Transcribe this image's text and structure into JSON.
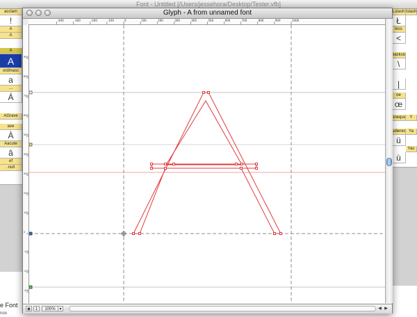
{
  "background_window": {
    "title": "Font - Untitled [/Users/jessehora/Desktop/Tester.vfb]",
    "left_columns": [
      {
        "header": "uni0041",
        "glyph": "!"
      },
      {
        "header": "A",
        "glyph": "A",
        "selected": true
      },
      {
        "header": "ordfeminine",
        "glyph": "a"
      },
      {
        "header": "...",
        "glyph": "À"
      },
      {
        "header": "Aacute",
        "glyph": "Á"
      },
      {
        "header": "...",
        "glyph": "â"
      },
      {
        "header": "ref",
        "glyph": ""
      }
    ],
    "left_headers_extra": [
      "acclam",
      "A",
      "ordmasc",
      "AGrave",
      "Acircumflex",
      "ave",
      "ef"
    ],
    "left_small_labels": [
      "A",
      "A",
      "A"
    ],
    "left_row_labels": [
      ".null",
      "Aacute"
    ],
    "right_columns": [
      {
        "header": "Lslash",
        "glyph": "Ł"
      },
      {
        "header": "less",
        "glyph": "<"
      },
      {
        "header": "backslash",
        "glyph": "\\"
      },
      {
        "header": "bar",
        "glyph": "|"
      },
      {
        "header": "oe",
        "glyph": "œ"
      },
      {
        "header": "onequarter",
        "glyph": "¼"
      },
      {
        "header": "udieresis",
        "glyph": "ü"
      },
      {
        "header": "udieresis",
        "glyph": "ù"
      }
    ],
    "right_far_headers": [
      "lslash",
      "Y",
      "Ya",
      "3/4",
      "Yac",
      "Ya",
      "Z"
    ],
    "bottom_text": "e Font",
    "bottom_text_small": "noo"
  },
  "glyph_window": {
    "title": "Glyph - A from unnamed font",
    "zoom": "100%",
    "status_button_1": "1",
    "ruler_top_labels": [
      "-400",
      "-300",
      "-200",
      "-100",
      "0",
      "100",
      "200",
      "300",
      "400",
      "500",
      "600",
      "700",
      "800",
      "900",
      "1000"
    ],
    "ruler_left_labels": [
      "900",
      "800",
      "700",
      "600",
      "500",
      "400",
      "300",
      "200",
      "100",
      "0",
      "-100",
      "-200",
      "-300"
    ]
  },
  "colors": {
    "outline": "#e0393e",
    "guide": "#8e8e8e",
    "selection": "#1a3ea8",
    "header_yellow": "#f6e38a"
  }
}
